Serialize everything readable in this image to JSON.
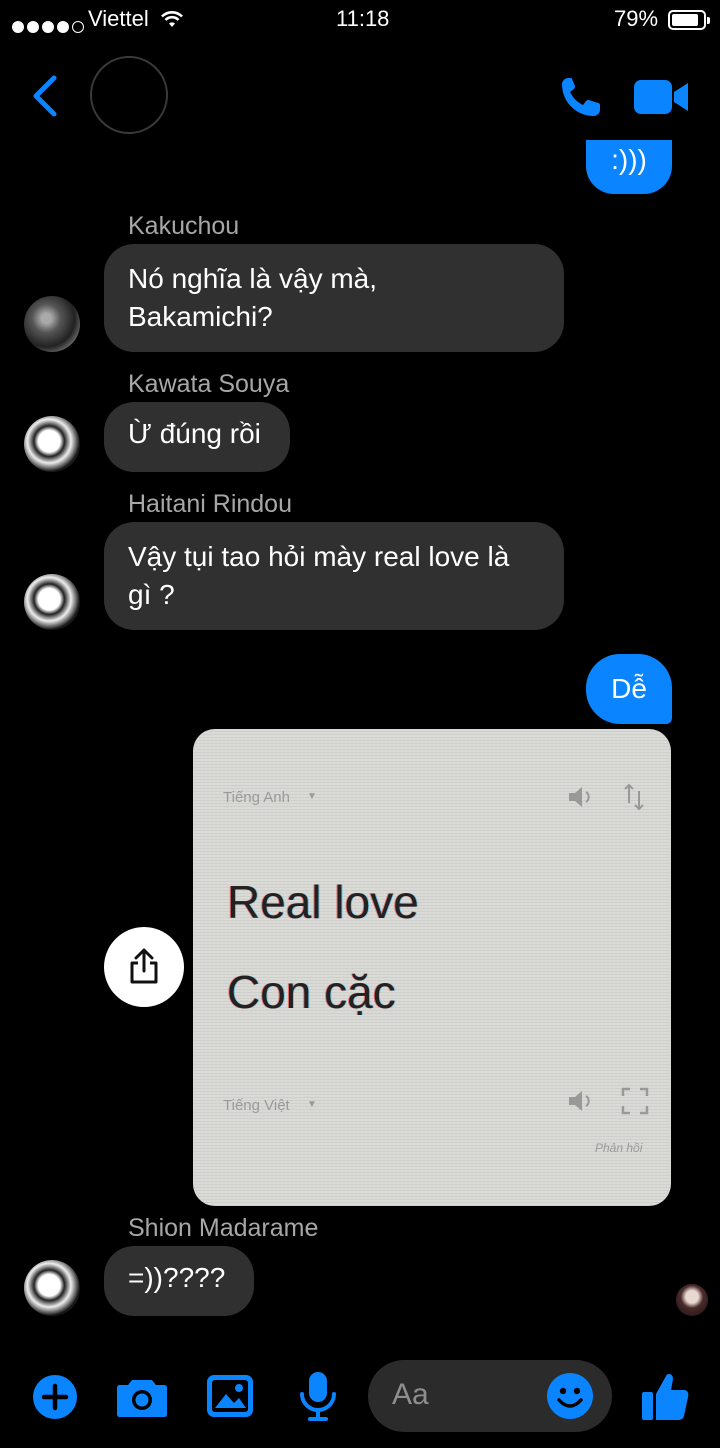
{
  "status_bar": {
    "carrier": "Viettel",
    "time": "11:18",
    "battery": "79%",
    "signal_bars": 4
  },
  "header": {
    "back_icon": "chevron-left-icon",
    "call_icon": "phone-icon",
    "video_icon": "video-camera-icon"
  },
  "messages": {
    "out_partial": ":)))",
    "kakuchou_name": "Kakuchou",
    "kakuchou_text_line1": "Nó nghĩa là vậy mà,",
    "kakuchou_text_line2": "Bakamichi?",
    "kawata_name": "Kawata Souya",
    "kawata_text": "Ừ đúng rồi",
    "haitani_name": "Haitani Rindou",
    "haitani_text_line1": "Vậy tụi tao hỏi mày real love là",
    "haitani_text_line2": "gì ?",
    "out_de": "Dễ",
    "shion_name": "Shion Madarame",
    "shion_text": "=))????"
  },
  "image_card": {
    "source_lang": "Tiếng Anh",
    "target_lang": "Tiếng Việt",
    "source_text": "Real love",
    "target_text": "Con cặc",
    "feedback": "Phản hồi"
  },
  "composer": {
    "placeholder": "Aa",
    "icons": [
      "plus-icon",
      "camera-icon",
      "image-icon",
      "microphone-icon",
      "emoji-icon",
      "thumbs-up-icon"
    ]
  },
  "colors": {
    "accent": "#0a84ff",
    "incoming_bubble": "#303030",
    "background": "#000000"
  }
}
